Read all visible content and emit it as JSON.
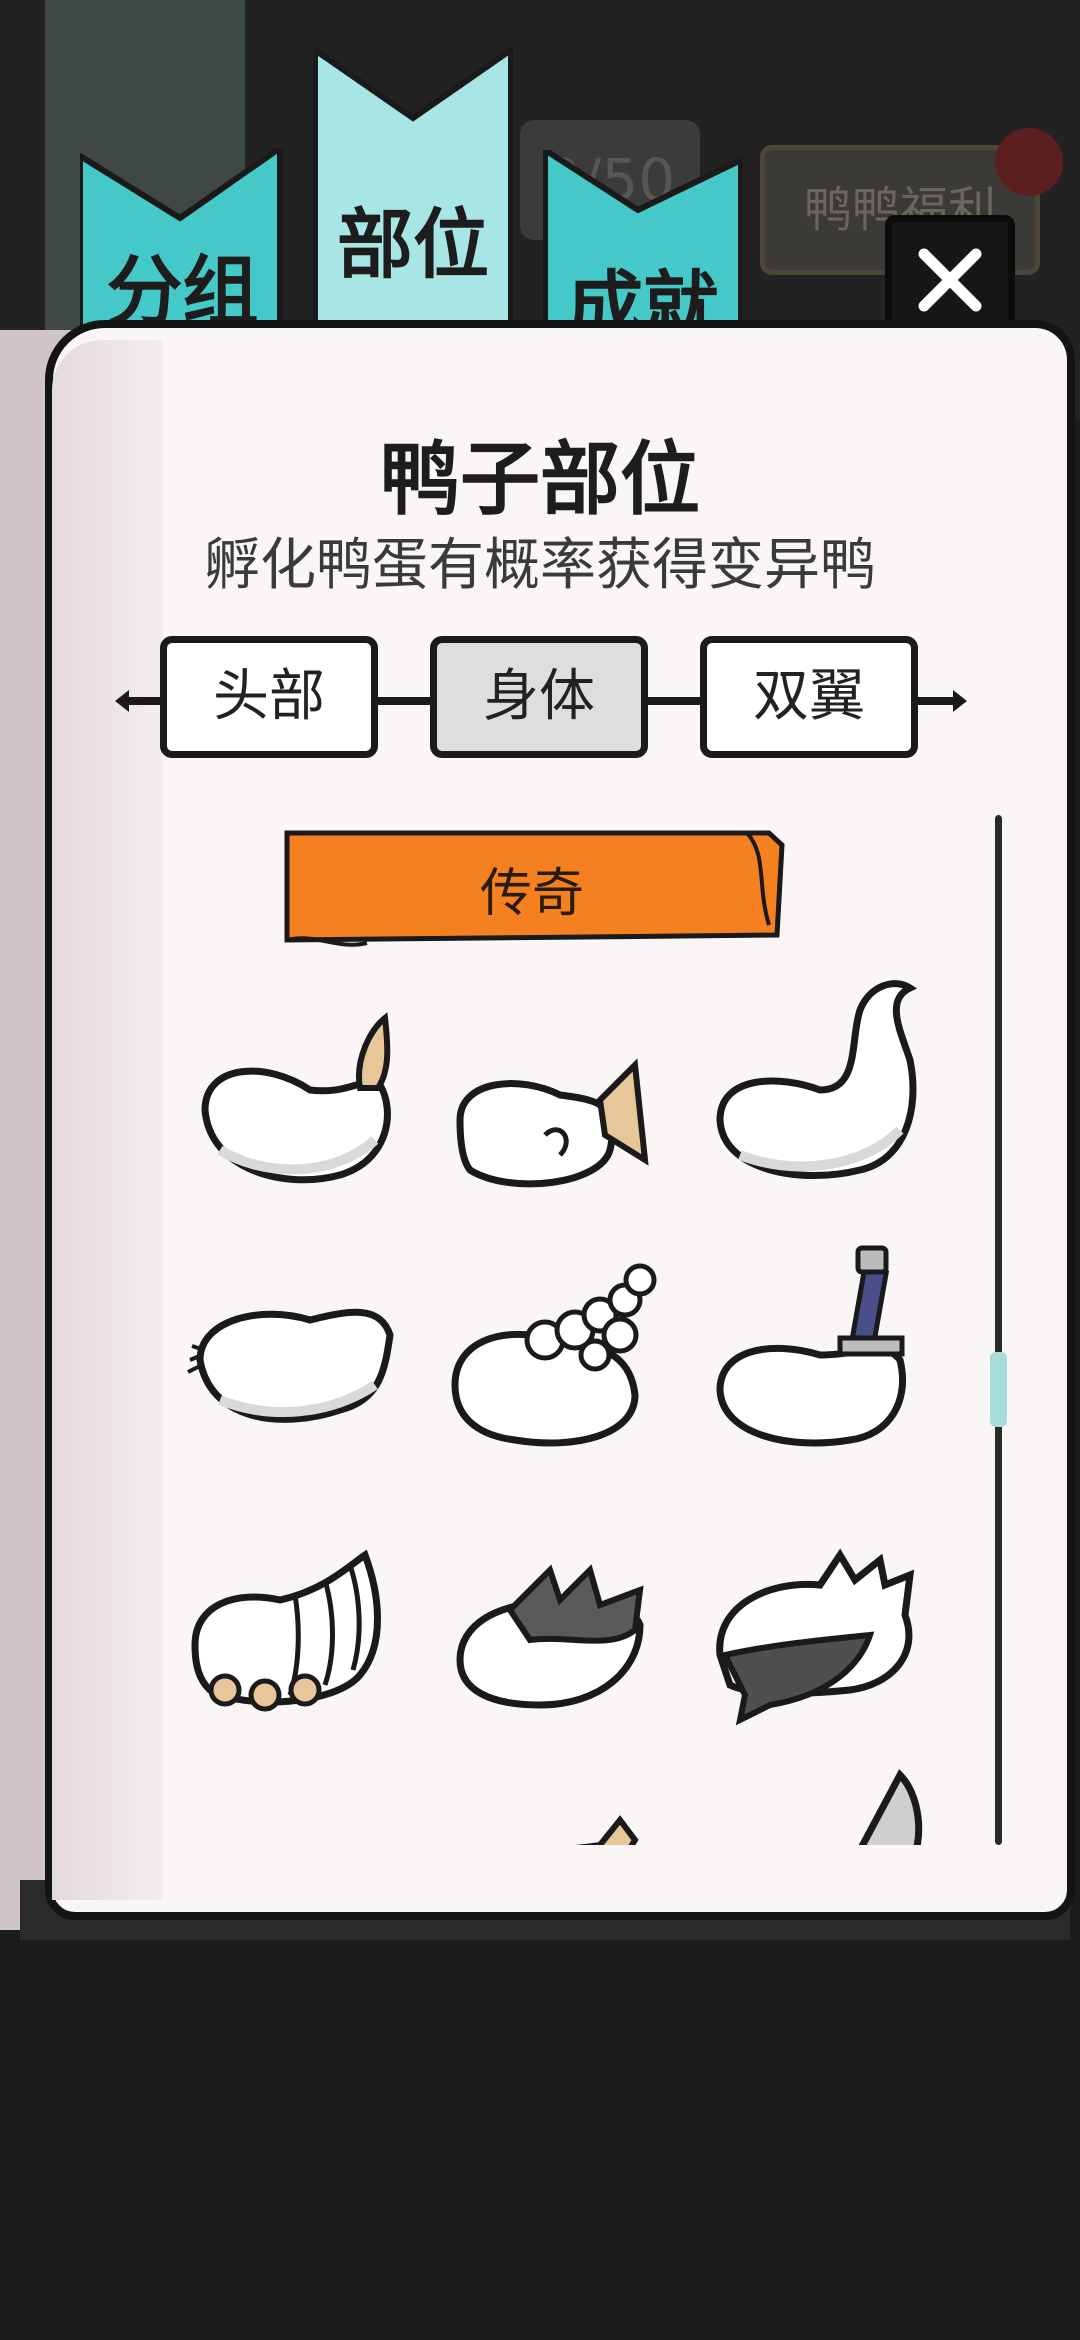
{
  "tabs": [
    {
      "label": "分组"
    },
    {
      "label": "部位"
    },
    {
      "label": "成就"
    }
  ],
  "background": {
    "counter_text": "9/50",
    "welfare_label": "鸭鸭福利"
  },
  "close_button": {
    "icon": "close-icon"
  },
  "panel": {
    "title": "鸭子部位",
    "subtitle": "孵化鸭蛋有概率获得变异鸭"
  },
  "categories": [
    {
      "label": "头部",
      "active": false
    },
    {
      "label": "身体",
      "active": true
    },
    {
      "label": "双翼",
      "active": false
    }
  ],
  "rarity_banner": {
    "label": "传奇",
    "color": "#f5801f"
  },
  "body_parts": [
    {
      "icon": "duck-body-brush-tail-icon"
    },
    {
      "icon": "duck-body-fish-tail-icon"
    },
    {
      "icon": "duck-body-curled-tail-icon"
    },
    {
      "icon": "duck-body-feather-tail-icon"
    },
    {
      "icon": "duck-body-bubble-back-icon"
    },
    {
      "icon": "duck-body-sword-icon"
    },
    {
      "icon": "duck-body-shell-claws-icon"
    },
    {
      "icon": "duck-body-dark-spikes-icon"
    },
    {
      "icon": "duck-body-fluffy-dark-icon"
    },
    {
      "icon": "duck-body-partial-icon"
    },
    {
      "icon": "duck-body-partial-wing-icon"
    },
    {
      "icon": "duck-body-horn-icon"
    }
  ],
  "colors": {
    "tab_teal": "#45c9c8",
    "tab_teal_active": "#a7e6e4",
    "page": "#faf6f6",
    "banner": "#f5801f"
  }
}
